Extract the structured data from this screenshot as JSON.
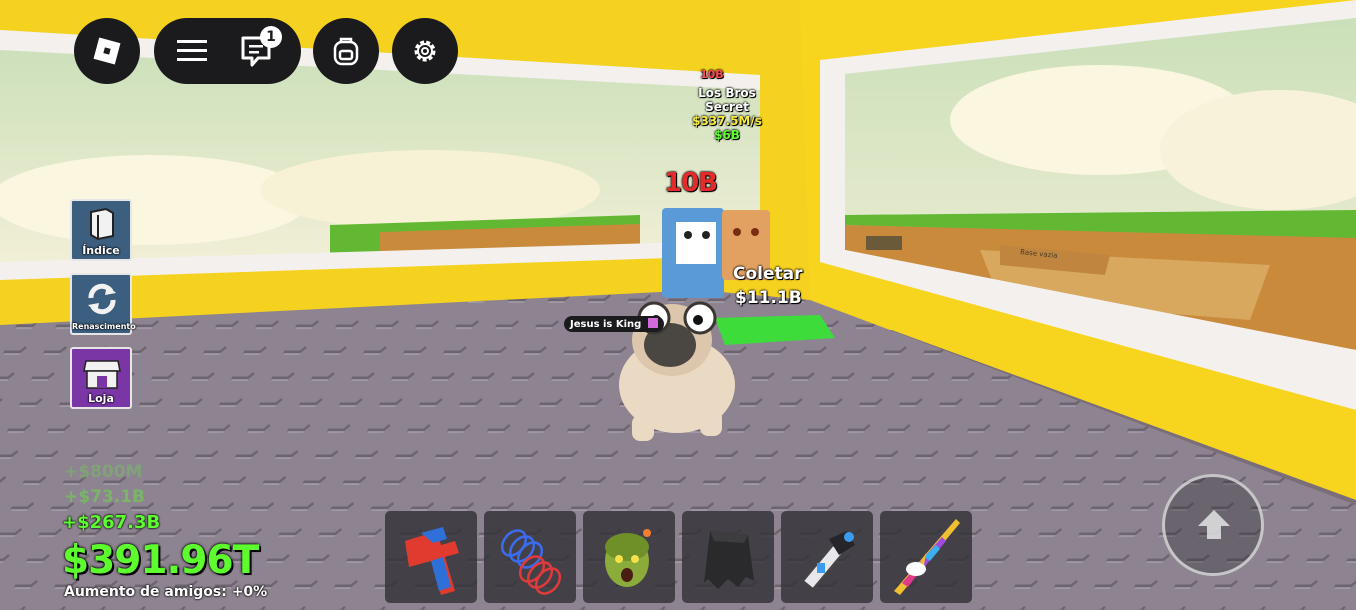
{
  "topbar": {
    "chat_badge_count": "1"
  },
  "sidebar": {
    "items": [
      {
        "label": "Índice",
        "icon": "book-icon",
        "color": "#3d5f7f"
      },
      {
        "label": "Renascimento",
        "icon": "refresh-icon",
        "color": "#3d5f7f"
      },
      {
        "label": "Loja",
        "icon": "shop-icon",
        "color": "#7b36a6"
      }
    ]
  },
  "world": {
    "pet_overhead": {
      "tag": "10B",
      "name": "Los Bros",
      "rarity": "Secret",
      "rate": "$337.5M/s",
      "price": "$6B"
    },
    "big_tag": "10B",
    "collect": {
      "label": "Coletar",
      "amount": "$11.1B"
    },
    "player_chat": "Jesus is King",
    "board_text": "Base vazia"
  },
  "stats": {
    "faded_line_1": "+$800M",
    "faded_line_2": "+$73.1B",
    "gain": "+$267.3B",
    "money": "$391.96T",
    "friend_boost": "Aumento de amigos: +0%"
  },
  "hotbar": {
    "slots": [
      {
        "item": "red-blue-cross-tool"
      },
      {
        "item": "coil-springs-tool"
      },
      {
        "item": "zombie-head-tool"
      },
      {
        "item": "black-cape-tool"
      },
      {
        "item": "grapple-gun-tool"
      },
      {
        "item": "rainbow-unicorn-sword-tool"
      }
    ]
  },
  "colors": {
    "money_green": "#5dfc2e",
    "wall_yellow": "#f7d21c",
    "floor_gray": "#8d8490",
    "ui_dark": "#1b1b1d"
  }
}
